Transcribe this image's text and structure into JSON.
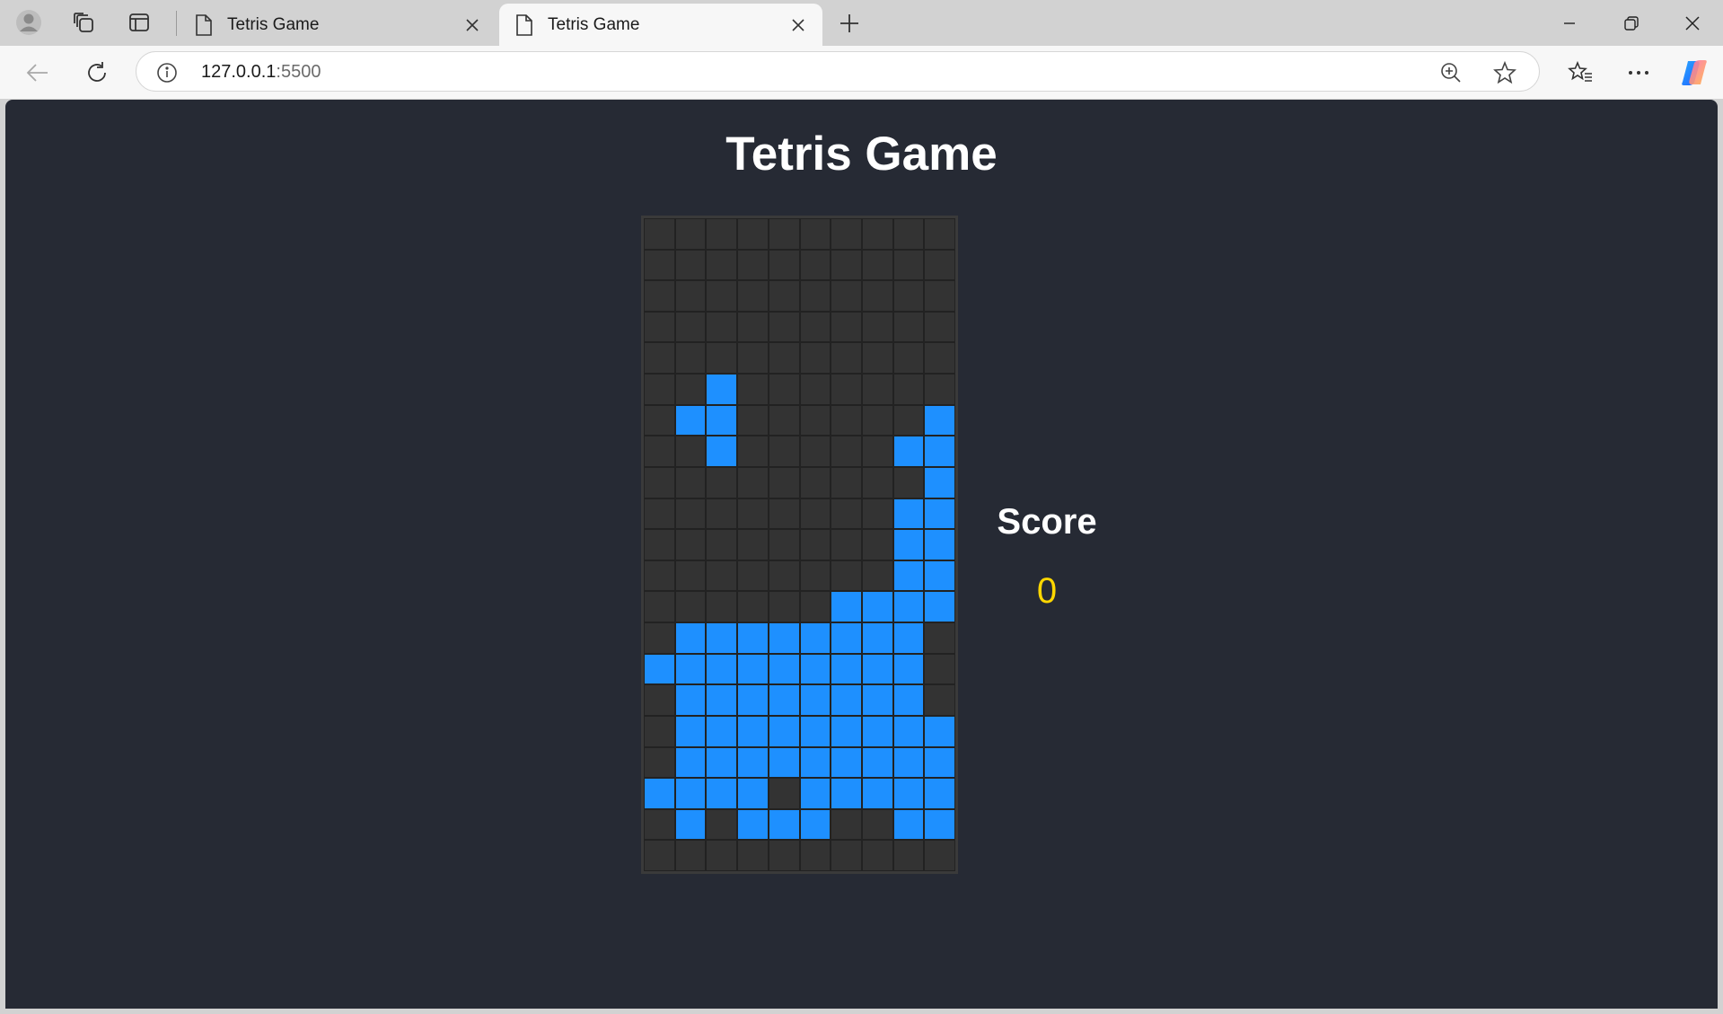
{
  "browser": {
    "tabs": [
      {
        "title": "Tetris Game",
        "active": false
      },
      {
        "title": "Tetris Game",
        "active": true
      }
    ],
    "url": {
      "host": "127.0.0.1",
      "port": ":5500"
    },
    "icons": [
      "profile-icon",
      "workspaces-icon",
      "vertical-tabs-icon",
      "page-icon",
      "close-icon",
      "new-tab-icon",
      "minimize-icon",
      "restore-icon",
      "window-close-icon",
      "back-icon",
      "refresh-icon",
      "site-info-icon",
      "zoom-icon",
      "favorite-star-icon",
      "favorites-icon",
      "more-icon",
      "copilot-icon"
    ]
  },
  "game": {
    "title": "Tetris Game",
    "score_label": "Score",
    "score_value": "0",
    "colors": {
      "block": "#1e90ff",
      "empty": "#333333",
      "score": "#ffd700",
      "background": "#262a34"
    },
    "board": {
      "cols": 10,
      "rows": 21,
      "grid": [
        "..........",
        "..........",
        "..........",
        "..........",
        "..........",
        "..#.......",
        ".##......#",
        "..#.....##",
        ".........#",
        "........##",
        "........##",
        "........##",
        "......####",
        ".########.",
        "#########.",
        ".########.",
        ".#########",
        ".#########",
        "####.#####",
        ".#.###..##",
        ".........."
      ]
    }
  }
}
